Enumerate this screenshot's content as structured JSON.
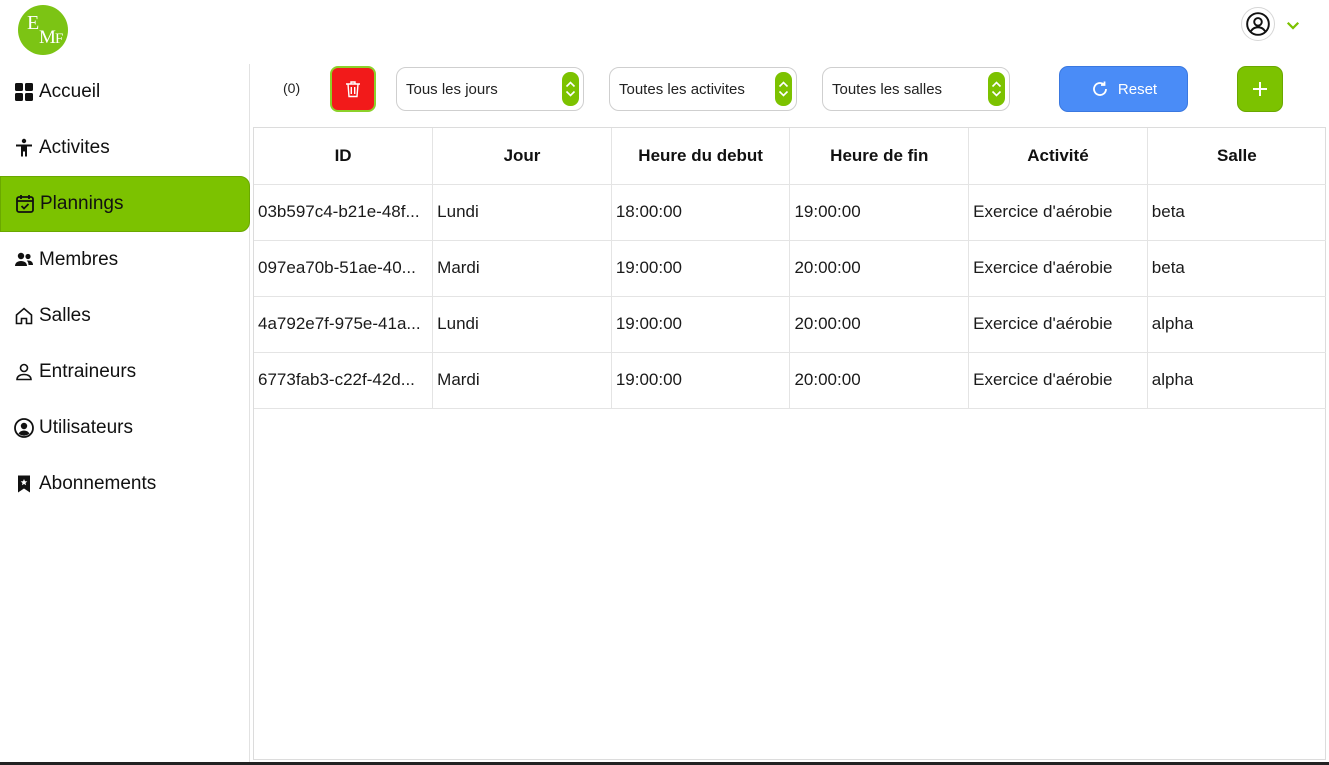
{
  "logo": {
    "text": "EMF",
    "color": "#7cc414"
  },
  "account": {
    "icon": "user-circle-icon",
    "menu_icon": "chevron-down-icon"
  },
  "sidebar": {
    "items": [
      {
        "label": "Accueil",
        "icon": "grid-icon"
      },
      {
        "label": "Activites",
        "icon": "person-icon"
      },
      {
        "label": "Plannings",
        "icon": "calendar-check-icon",
        "active": true
      },
      {
        "label": "Membres",
        "icon": "people-icon"
      },
      {
        "label": "Salles",
        "icon": "home-icon"
      },
      {
        "label": "Entraineurs",
        "icon": "user-icon"
      },
      {
        "label": "Utilisateurs",
        "icon": "user-circle-icon"
      },
      {
        "label": "Abonnements",
        "icon": "bookmark-star-icon"
      }
    ]
  },
  "toolbar": {
    "selected_count": "(0)",
    "filters": {
      "day": "Tous les jours",
      "activity": "Toutes les activites",
      "room": "Toutes les salles"
    },
    "reset_label": "Reset"
  },
  "table": {
    "columns": [
      "ID",
      "Jour",
      "Heure du debut",
      "Heure de fin",
      "Activité",
      "Salle"
    ],
    "rows": [
      [
        "03b597c4-b21e-48f...",
        "Lundi",
        "18:00:00",
        "19:00:00",
        "Exercice d'aérobie",
        "beta"
      ],
      [
        "097ea70b-51ae-40...",
        "Mardi",
        "19:00:00",
        "20:00:00",
        "Exercice d'aérobie",
        "beta"
      ],
      [
        "4a792e7f-975e-41a...",
        "Lundi",
        "19:00:00",
        "20:00:00",
        "Exercice d'aérobie",
        "alpha"
      ],
      [
        "6773fab3-c22f-42d...",
        "Mardi",
        "19:00:00",
        "20:00:00",
        "Exercice d'aérobie",
        "alpha"
      ]
    ]
  },
  "colors": {
    "accent": "#7cc200",
    "danger": "#f21a1a",
    "primary": "#4a8cf7"
  }
}
